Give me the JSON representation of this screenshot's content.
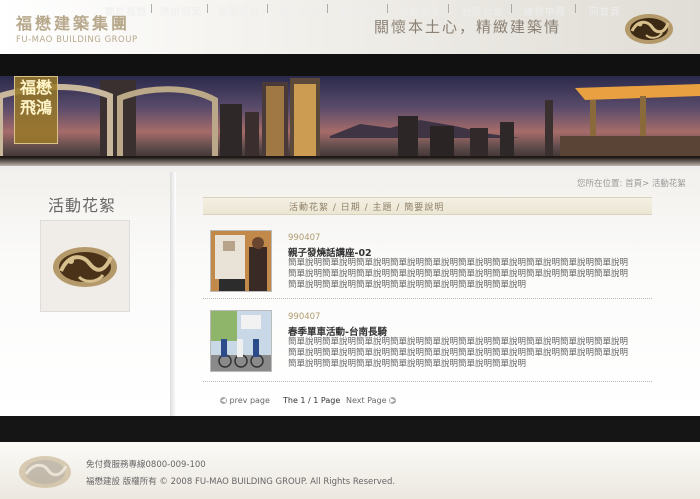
{
  "header": {
    "brand_zh": "福懋建築集團",
    "brand_en": "FU-MAO BUILDING GROUP",
    "slogan": "關懷本土心，精緻建築情"
  },
  "nav": {
    "items": [
      "關於福懋",
      "熱銷個案",
      "建築精選",
      "客戶服務",
      "最新消息",
      "活動花絮",
      "社區公告",
      "維修申報",
      "回首頁"
    ],
    "separator": "|"
  },
  "banner": {
    "badge_text": "福懋\n飛鴻"
  },
  "sidebar": {
    "title": "活動花絮"
  },
  "breadcrumb": "您所在位置: 首頁> 活動花絮",
  "list": {
    "header": "活動花絮 / 日期 / 主題 / 簡要說明",
    "items": [
      {
        "date": "990407",
        "title": "親子發燒話講座-02",
        "desc": "簡單說明簡單說明簡單說明簡單說明簡單說明簡單說明簡單說明簡單說明簡單說明簡單說明簡單說明簡單說明簡單說明簡單說明簡單說明簡單說明簡單說明簡單說明簡單說明簡單說明簡單說明簡單說明簡單說明簡單說明簡單說明簡單說明簡單說明"
      },
      {
        "date": "990407",
        "title": "春季單車活動-台南長騎",
        "desc": "簡單說明簡單說明簡單說明簡單說明簡單說明簡單說明簡單說明簡單說明簡單說明簡單說明簡單說明簡單說明簡單說明簡單說明簡單說明簡單說明簡單說明簡單說明簡單說明簡單說明簡單說明簡單說明簡單說明簡單說明簡單說明簡單說明簡單說明"
      }
    ]
  },
  "pager": {
    "prev": "prev page",
    "status": "The 1 / 1 Page",
    "next": "Next Page"
  },
  "footer": {
    "hotline": "免付費服務專線0800-009-100",
    "copyright": "福懋建設  版權所有 © 2008 FU-MAO BUILDING GROUP. All Rights Reserved."
  },
  "colors": {
    "accent_gold": "#b8a98d",
    "nav_bg": "#111111",
    "date_color": "#b09b6e"
  }
}
